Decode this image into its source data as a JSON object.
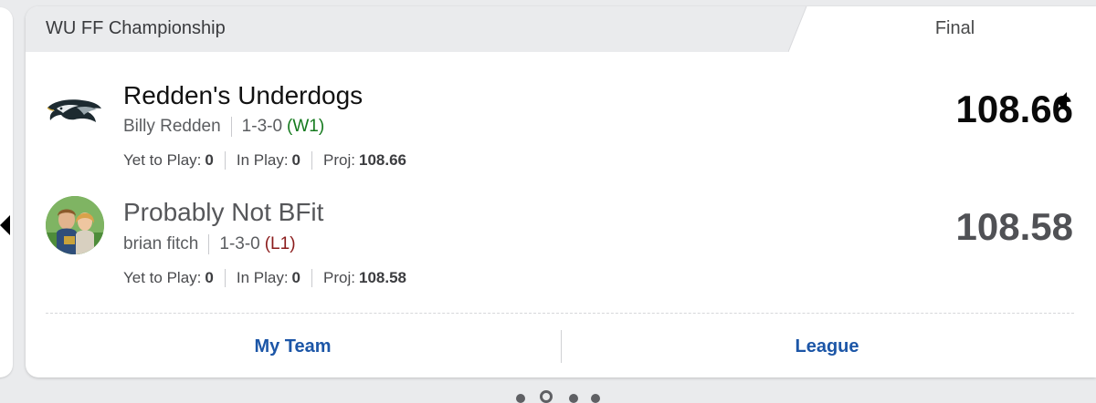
{
  "header": {
    "title": "WU FF Championship",
    "status": "Final"
  },
  "teams": [
    {
      "name": "Redden's Underdogs",
      "owner": "Billy Redden",
      "record": "1-3-0",
      "streak": "(W1)",
      "yet_to_play_label": "Yet to Play:",
      "yet_to_play": "0",
      "in_play_label": "In Play:",
      "in_play": "0",
      "proj_label": "Proj:",
      "proj": "108.66",
      "score": "108.66",
      "logo_icon": "eagle-logo-icon"
    },
    {
      "name": "Probably Not BFit",
      "owner": "brian fitch",
      "record": "1-3-0",
      "streak": "(L1)",
      "yet_to_play_label": "Yet to Play:",
      "yet_to_play": "0",
      "in_play_label": "In Play:",
      "in_play": "0",
      "proj_label": "Proj:",
      "proj": "108.58",
      "score": "108.58",
      "logo_icon": "avatar-photo"
    }
  ],
  "footer": {
    "my_team_label": "My Team",
    "league_label": "League"
  },
  "colors": {
    "link": "#1c56a7",
    "win": "#157a1e",
    "loss": "#8b1b1b",
    "background": "#eaebed"
  },
  "pagination": {
    "dot_count": 4,
    "active_index": 1
  }
}
